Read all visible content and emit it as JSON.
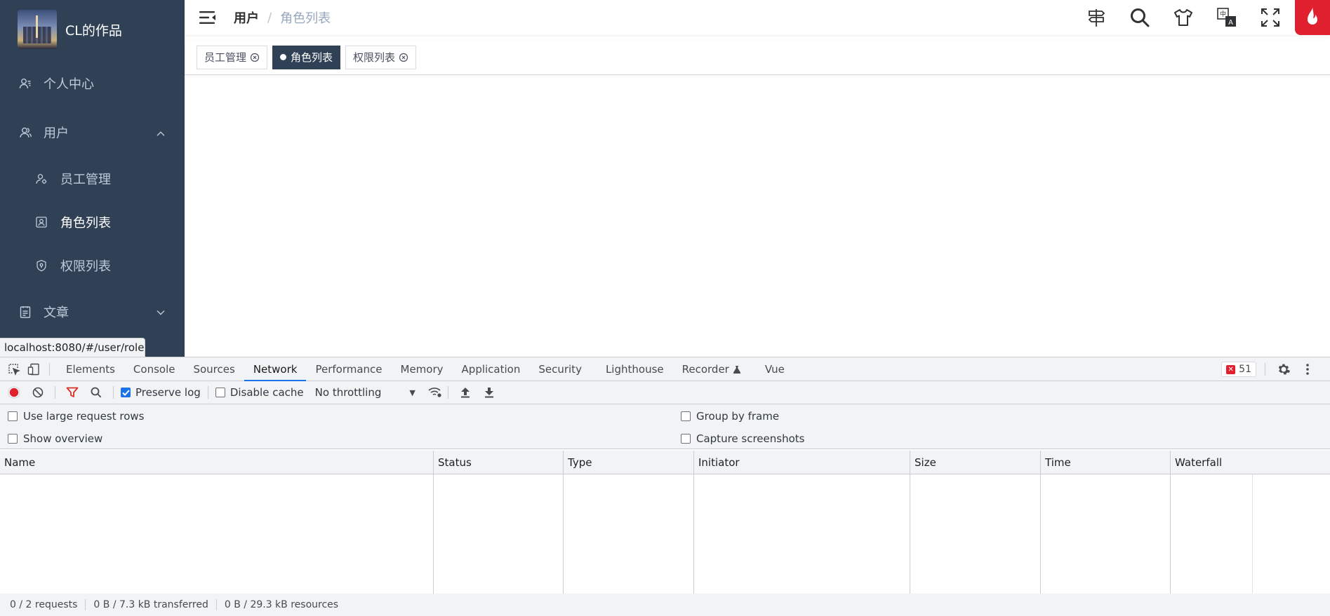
{
  "sidebar": {
    "title": "CL的作品",
    "menu": [
      {
        "label": "个人中心",
        "icon": "user-card-icon"
      },
      {
        "label": "用户",
        "icon": "users-icon",
        "expanded": true
      },
      {
        "label": "文章",
        "icon": "document-icon",
        "expanded": false
      }
    ],
    "submenu": [
      {
        "label": "员工管理",
        "icon": "staff-icon"
      },
      {
        "label": "角色列表",
        "icon": "role-icon",
        "active": true
      },
      {
        "label": "权限列表",
        "icon": "shield-icon"
      }
    ]
  },
  "url_tooltip": "localhost:8080/#/user/role",
  "breadcrumb": {
    "parent": "用户",
    "separator": "/",
    "current": "角色列表"
  },
  "tags": [
    {
      "label": "员工管理",
      "active": false
    },
    {
      "label": "角色列表",
      "active": true
    },
    {
      "label": "权限列表",
      "active": false
    }
  ],
  "devtools": {
    "tabs": [
      "Elements",
      "Console",
      "Sources",
      "Network",
      "Performance",
      "Memory",
      "Application",
      "Security",
      "Lighthouse",
      "Recorder",
      "Vue"
    ],
    "active_tab": "Network",
    "error_count": "51",
    "toolbar": {
      "preserve_log": "Preserve log",
      "preserve_log_checked": true,
      "disable_cache": "Disable cache",
      "disable_cache_checked": false,
      "throttling": "No throttling"
    },
    "settings": {
      "large_rows": "Use large request rows",
      "show_overview": "Show overview",
      "group_by_frame": "Group by frame",
      "capture_screenshots": "Capture screenshots"
    },
    "columns": [
      "Name",
      "Status",
      "Type",
      "Initiator",
      "Size",
      "Time",
      "Waterfall"
    ],
    "status": {
      "requests": "0 / 2 requests",
      "transferred": "0 B / 7.3 kB transferred",
      "resources": "0 B / 29.3 kB resources"
    }
  },
  "colors": {
    "sidebar": "#304156",
    "accent": "#1a73e8",
    "danger": "#e0202e"
  }
}
